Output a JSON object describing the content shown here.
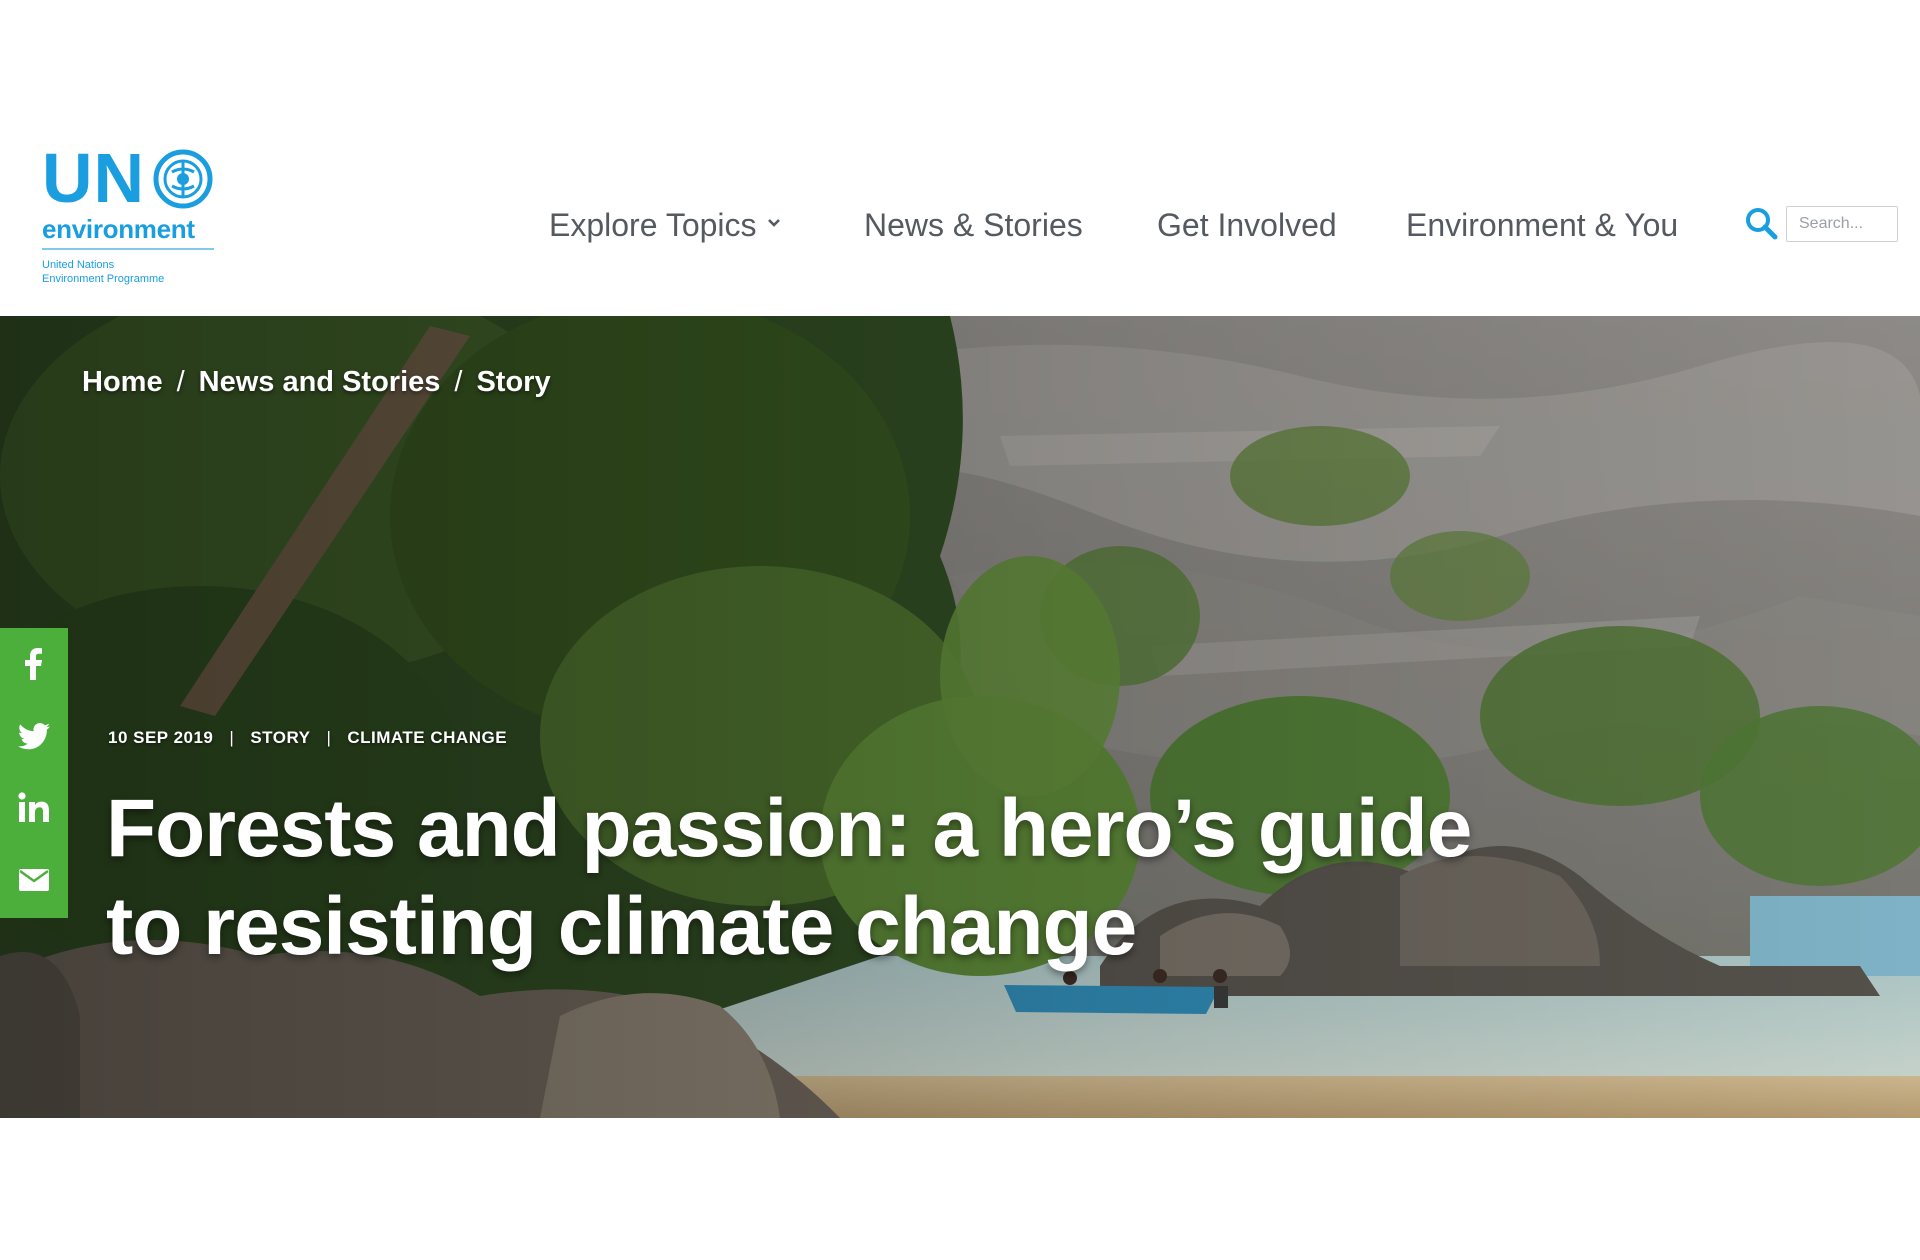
{
  "logo": {
    "wordmark": "UN",
    "subwordmark": "environment",
    "subtitle_line1": "United Nations",
    "subtitle_line2": "Environment Programme",
    "emblem_icon": "un-emblem-icon"
  },
  "nav": {
    "items": [
      {
        "label": "Explore Topics",
        "has_dropdown": true
      },
      {
        "label": "News & Stories"
      },
      {
        "label": "Get Involved"
      },
      {
        "label": "Environment & You"
      }
    ]
  },
  "search": {
    "placeholder": "Search...",
    "icon": "search-icon"
  },
  "breadcrumb": {
    "items": [
      "Home",
      "News and Stories",
      "Story"
    ],
    "separator": "/"
  },
  "article": {
    "date": "10 SEP 2019",
    "type": "STORY",
    "topic": "CLIMATE CHANGE",
    "meta_separator": "|",
    "title": "Forests and passion: a hero’s guide to resisting climate change"
  },
  "share": {
    "buttons": [
      {
        "icon": "facebook-icon"
      },
      {
        "icon": "twitter-icon"
      },
      {
        "icon": "linkedin-icon"
      },
      {
        "icon": "email-icon"
      }
    ]
  },
  "colors": {
    "brand_blue": "#1a9ee0",
    "nav_text": "#555a60",
    "share_green": "#4caf3b"
  }
}
